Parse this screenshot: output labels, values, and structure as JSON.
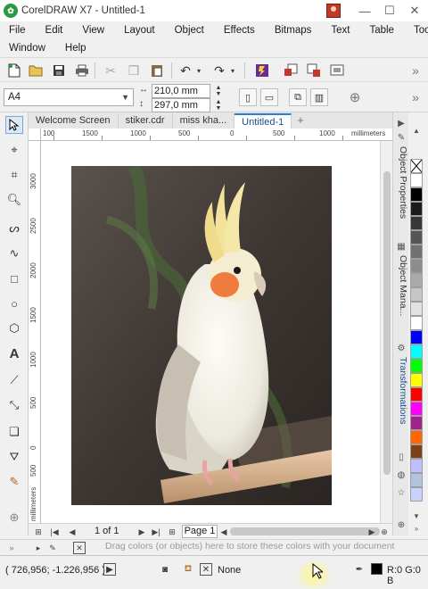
{
  "window": {
    "title": "CorelDRAW X7 - Untitled-1",
    "minimize": "—",
    "maximize": "☐",
    "close": "✕"
  },
  "menu": {
    "row1": [
      "File",
      "Edit",
      "View",
      "Layout",
      "Object",
      "Effects",
      "Bitmaps",
      "Text",
      "Table",
      "Tools"
    ],
    "row2": [
      "Window",
      "Help"
    ]
  },
  "toolbar": {
    "overflow": "»"
  },
  "property_bar": {
    "page_size": "A4",
    "width": "210,0 mm",
    "height": "297,0 mm"
  },
  "document_tabs": [
    "Welcome Screen",
    "stiker.cdr",
    "miss kha...",
    "Untitled-1"
  ],
  "active_tab": "Untitled-1",
  "ruler": {
    "h_labels": [
      "100",
      "1500",
      "1000",
      "500",
      "0",
      "500",
      "1000",
      "millimeters"
    ],
    "v_labels": [
      "3000",
      "2500",
      "2000",
      "1500",
      "1000",
      "500",
      "0",
      "500",
      "millimeters"
    ]
  },
  "dockers": [
    "Object Properties",
    "Object Mana...",
    "Transformations"
  ],
  "palette_colors": [
    "#ffffff",
    "#000000",
    "#1c1c1c",
    "#383838",
    "#555555",
    "#717171",
    "#8d8d8d",
    "#aaaaaa",
    "#c6c6c6",
    "#e2e2e2",
    "#ffffff",
    "#0000ff",
    "#00ffff",
    "#00ff00",
    "#ffff00",
    "#ff0000",
    "#ff00ff",
    "#a0228d",
    "#ff6600",
    "#7f3f1a",
    "#bfbfff",
    "#b0c4de",
    "#c8d2ff"
  ],
  "pager": {
    "page_count": "1 of 1",
    "page_tab": "Page 1"
  },
  "color_well": {
    "hint": "Drag colors (or objects) here to store these colors with your document"
  },
  "status": {
    "coordinates": "( 726,956; -1.226,956 )",
    "fill": "None",
    "outline": "R:0 G:0 B"
  }
}
